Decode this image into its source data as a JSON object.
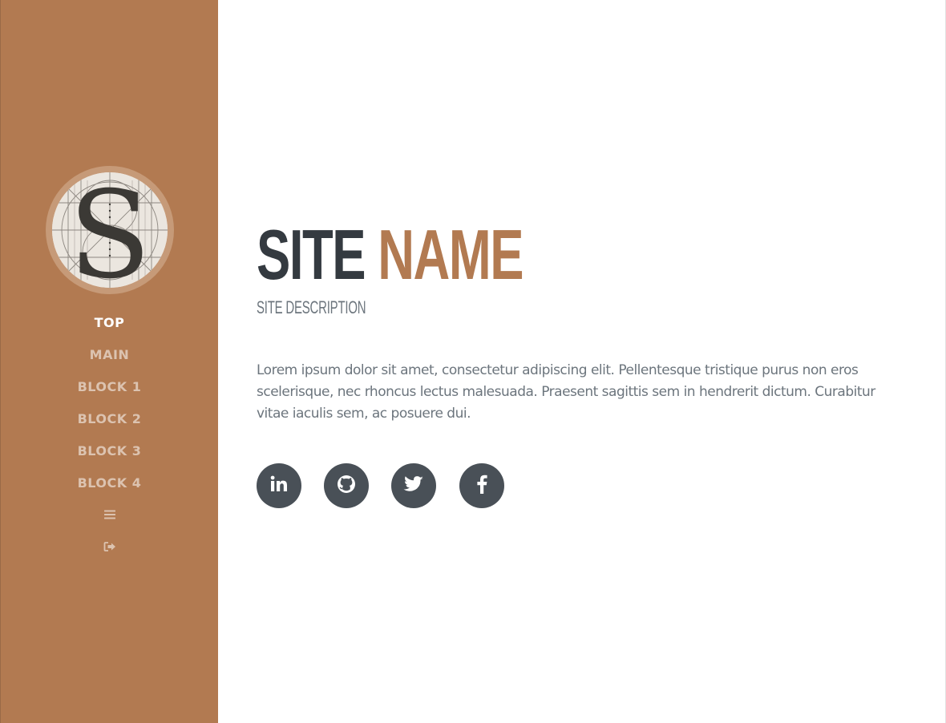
{
  "sidebar": {
    "nav": [
      {
        "label": "TOP",
        "active": true
      },
      {
        "label": "MAIN",
        "active": false
      },
      {
        "label": "BLOCK 1",
        "active": false
      },
      {
        "label": "BLOCK 2",
        "active": false
      },
      {
        "label": "BLOCK 3",
        "active": false
      },
      {
        "label": "BLOCK 4",
        "active": false
      }
    ],
    "icons": [
      "menu-icon",
      "sign-out-icon"
    ]
  },
  "main": {
    "title_first": "SITE",
    "title_second": "NAME",
    "subtitle": "SITE DESCRIPTION",
    "lead": "Lorem ipsum dolor sit amet, consectetur adipiscing elit. Pellentesque tristique purus non eros scelerisque, nec rhoncus lectus malesuada. Praesent sagittis sem in hendrerit dictum. Curabitur vitae iaculis sem, ac posuere dui.",
    "social": [
      "linkedin-icon",
      "github-icon",
      "twitter-icon",
      "facebook-icon"
    ]
  },
  "colors": {
    "sidebar_bg": "#b27a51",
    "accent": "#b27a51",
    "title_dark": "#343a40",
    "text_muted": "#6c757d",
    "social_bg": "#495057"
  }
}
